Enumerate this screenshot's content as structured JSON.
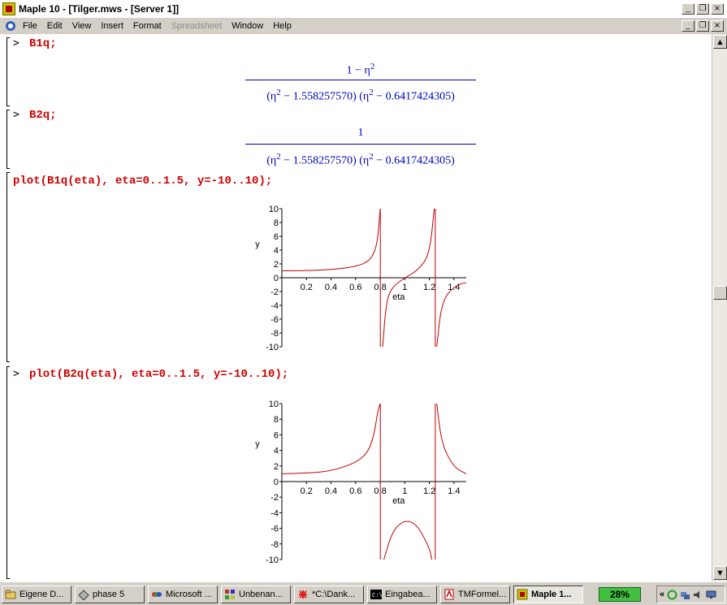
{
  "window": {
    "title": "Maple 10 - [Tilger.mws - [Server 1]]",
    "controls": {
      "minimize": "_",
      "restore": "❐",
      "close": "×"
    }
  },
  "menubar": {
    "items": [
      {
        "label": "File",
        "disabled": false
      },
      {
        "label": "Edit",
        "disabled": false
      },
      {
        "label": "View",
        "disabled": false
      },
      {
        "label": "Insert",
        "disabled": false
      },
      {
        "label": "Format",
        "disabled": false
      },
      {
        "label": "Spreadsheet",
        "disabled": true
      },
      {
        "label": "Window",
        "disabled": false
      },
      {
        "label": "Help",
        "disabled": false
      }
    ]
  },
  "worksheet": {
    "prompt": ">",
    "groups": [
      {
        "input": "B1q;",
        "output": {
          "numerator": "1 − η",
          "numerator_exp": "2",
          "denominator_a": "(η",
          "denominator_a_exp": "2",
          "denominator_a_rest": " − 1.558257570) (η",
          "denominator_b_exp": "2",
          "denominator_b_rest": " − 0.6417424305)"
        }
      },
      {
        "input": "B2q;",
        "output": {
          "numerator": "1",
          "denominator_a": "(η",
          "denominator_a_exp": "2",
          "denominator_a_rest": " − 1.558257570) (η",
          "denominator_b_exp": "2",
          "denominator_b_rest": " − 0.6417424305)"
        }
      },
      {
        "input": "plot(B1q(eta), eta=0..1.5, y=-10..10);"
      },
      {
        "input": "plot(B2q(eta), eta=0..1.5, y=-10..10);"
      }
    ]
  },
  "chart_data": [
    {
      "type": "line",
      "function": "B1q",
      "xlabel": "eta",
      "ylabel": "y",
      "xlim": [
        0,
        1.5
      ],
      "ylim": [
        -10,
        10
      ],
      "x_ticks": [
        "0.2",
        "0.4",
        "0.6",
        "0.8",
        "1",
        "1.2",
        "1.4"
      ],
      "y_ticks": [
        "10",
        "8",
        "6",
        "4",
        "2",
        "0",
        "-2",
        "-4",
        "-6",
        "-8",
        "-10"
      ],
      "poles": [
        0.801,
        1.248
      ],
      "color": "#c00000",
      "series": [
        {
          "x": [
            0,
            0.2,
            0.4,
            0.6,
            0.7,
            0.75,
            0.78,
            0.8,
            0.82,
            0.85,
            0.9,
            1.0,
            1.1,
            1.2,
            1.24,
            1.26,
            1.3,
            1.4,
            1.5
          ],
          "y": [
            1.0,
            1.04,
            1.17,
            1.6,
            2.3,
            3.5,
            5.5,
            10,
            -10,
            -3.3,
            -1.3,
            0,
            1.0,
            3.2,
            10,
            -10,
            -3.5,
            -1.2,
            -0.7
          ]
        }
      ]
    },
    {
      "type": "line",
      "function": "B2q",
      "xlabel": "eta",
      "ylabel": "y",
      "xlim": [
        0,
        1.5
      ],
      "ylim": [
        -10,
        10
      ],
      "x_ticks": [
        "0.2",
        "0.4",
        "0.6",
        "0.8",
        "1",
        "1.2",
        "1.4"
      ],
      "y_ticks": [
        "10",
        "8",
        "6",
        "4",
        "2",
        "0",
        "-2",
        "-4",
        "-6",
        "-8",
        "-10"
      ],
      "poles": [
        0.801,
        1.248
      ],
      "color": "#c00000",
      "series": [
        {
          "x": [
            0,
            0.2,
            0.4,
            0.6,
            0.7,
            0.75,
            0.78,
            0.8,
            0.83,
            0.9,
            1.0,
            1.1,
            1.2,
            1.22,
            1.26,
            1.3,
            1.4,
            1.5
          ],
          "y": [
            1.0,
            1.08,
            1.34,
            2.4,
            3.7,
            6,
            9,
            10,
            -10,
            -6.3,
            -4.9,
            -5.5,
            -8.5,
            -10,
            10,
            4.8,
            1.8,
            1.0
          ]
        }
      ]
    }
  ],
  "taskbar": {
    "buttons": [
      {
        "label": "Eigene D...",
        "icon": "folder-icon",
        "active": false
      },
      {
        "label": "phase 5",
        "icon": "drive-icon",
        "active": false
      },
      {
        "label": "Microsoft ...",
        "icon": "office-icon",
        "active": false
      },
      {
        "label": "Unbenan...",
        "icon": "paint-icon",
        "active": false
      },
      {
        "label": "*C:\\Dank...",
        "icon": "editor-icon",
        "active": false
      },
      {
        "label": "Eingabea...",
        "icon": "console-icon",
        "active": false
      },
      {
        "label": "TMFormel...",
        "icon": "pdf-icon",
        "active": false
      },
      {
        "label": "Maple 1...",
        "icon": "maple-icon",
        "active": true
      }
    ],
    "battery": "28%",
    "tray_expand": "«"
  }
}
